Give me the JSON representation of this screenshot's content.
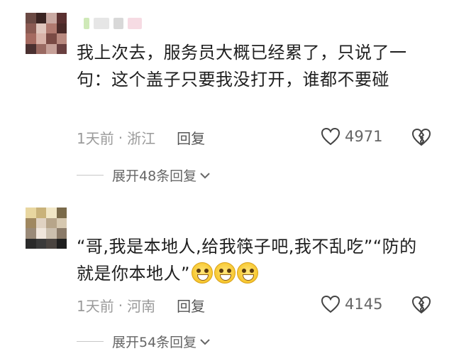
{
  "comments": [
    {
      "text": "我上次去，服务员大概已经累了，只说了一句：这个盖子只要我没打开，谁都不要碰",
      "time": "1天前",
      "sep": "·",
      "location": "浙江",
      "reply_label": "回复",
      "likes": "4971",
      "expand_label": "展开48条回复"
    },
    {
      "text": "“哥,我是本地人,给我筷子吧,我不乱吃”“防的就是你本地人”",
      "emojis": [
        "grin-emoji",
        "grin-emoji",
        "grin-emoji"
      ],
      "time": "1天前",
      "sep": "·",
      "location": "河南",
      "reply_label": "回复",
      "likes": "4145",
      "expand_label": "展开54条回复"
    }
  ],
  "colors": {
    "text": "#1f1f1f",
    "meta": "#9a9a9a",
    "accent": "#666666"
  }
}
